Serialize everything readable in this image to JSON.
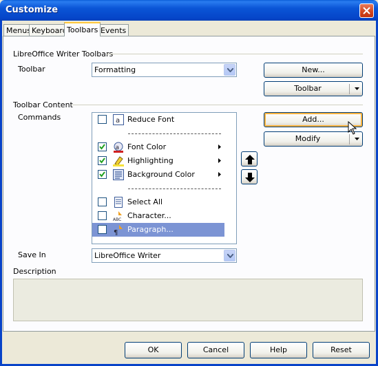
{
  "window": {
    "title": "Customize"
  },
  "tabs": [
    {
      "label": "Menus"
    },
    {
      "label": "Keyboard"
    },
    {
      "label": "Toolbars"
    },
    {
      "label": "Events"
    }
  ],
  "toolbars_section": {
    "heading": "LibreOffice Writer Toolbars",
    "toolbar_label": "Toolbar",
    "toolbar_value": "Formatting",
    "new_button": "New...",
    "toolbar_menu_button": "Toolbar"
  },
  "content_section": {
    "heading": "Toolbar Content",
    "commands_label": "Commands",
    "add_button": "Add...",
    "modify_button": "Modify",
    "commands": [
      {
        "label": "Reduce Font",
        "checked": false,
        "icon": "reduce-font-icon",
        "submenu": false
      },
      {
        "divider": true
      },
      {
        "label": "Font Color",
        "checked": true,
        "icon": "font-color-icon",
        "submenu": true
      },
      {
        "label": "Highlighting",
        "checked": true,
        "icon": "highlighting-icon",
        "submenu": true
      },
      {
        "label": "Background Color",
        "checked": true,
        "icon": "background-color-icon",
        "submenu": true
      },
      {
        "divider": true
      },
      {
        "label": "Select All",
        "checked": false,
        "icon": "select-all-icon",
        "submenu": false
      },
      {
        "label": "Character...",
        "checked": false,
        "icon": "character-icon",
        "submenu": false
      },
      {
        "label": "Paragraph...",
        "checked": false,
        "icon": "paragraph-icon",
        "submenu": false,
        "selected": true
      }
    ]
  },
  "save_in": {
    "label": "Save In",
    "value": "LibreOffice Writer"
  },
  "description": {
    "label": "Description",
    "text": ""
  },
  "footer": {
    "ok": "OK",
    "cancel": "Cancel",
    "help": "Help",
    "reset": "Reset"
  },
  "colors": {
    "titlebar": "#0a55d6",
    "selection": "#7c94d4",
    "focus": "#f8b33f",
    "dialog_bg": "#ece9d8"
  }
}
